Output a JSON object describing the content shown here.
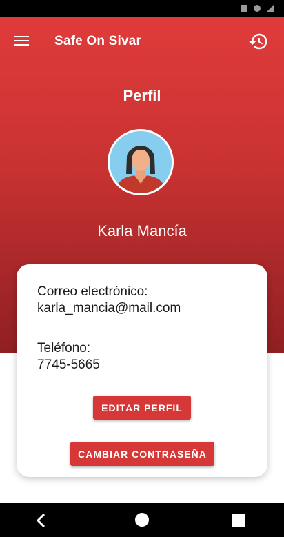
{
  "colors": {
    "accent": "#d63838",
    "header_top": "#e03b3b",
    "header_bottom": "#8f1f22",
    "card_background": "#ffffff"
  },
  "app_bar": {
    "title": "Safe On Sivar",
    "menu_icon": "hamburger-menu-icon",
    "history_icon": "history-icon"
  },
  "profile": {
    "page_title": "Perfil",
    "avatar_icon": "female-avatar-icon",
    "name": "Karla Mancía"
  },
  "details": {
    "email_label": "Correo electrónico:",
    "email_value": "karla_mancia@mail.com",
    "phone_label": "Teléfono:",
    "phone_value": "7745-5665"
  },
  "actions": {
    "edit_label": "EDITAR PERFIL",
    "change_password_label": "CAMBIAR CONTRASEÑA"
  },
  "nav": {
    "back_icon": "back-triangle-icon",
    "home_icon": "home-circle-icon",
    "recents_icon": "recents-square-icon"
  }
}
